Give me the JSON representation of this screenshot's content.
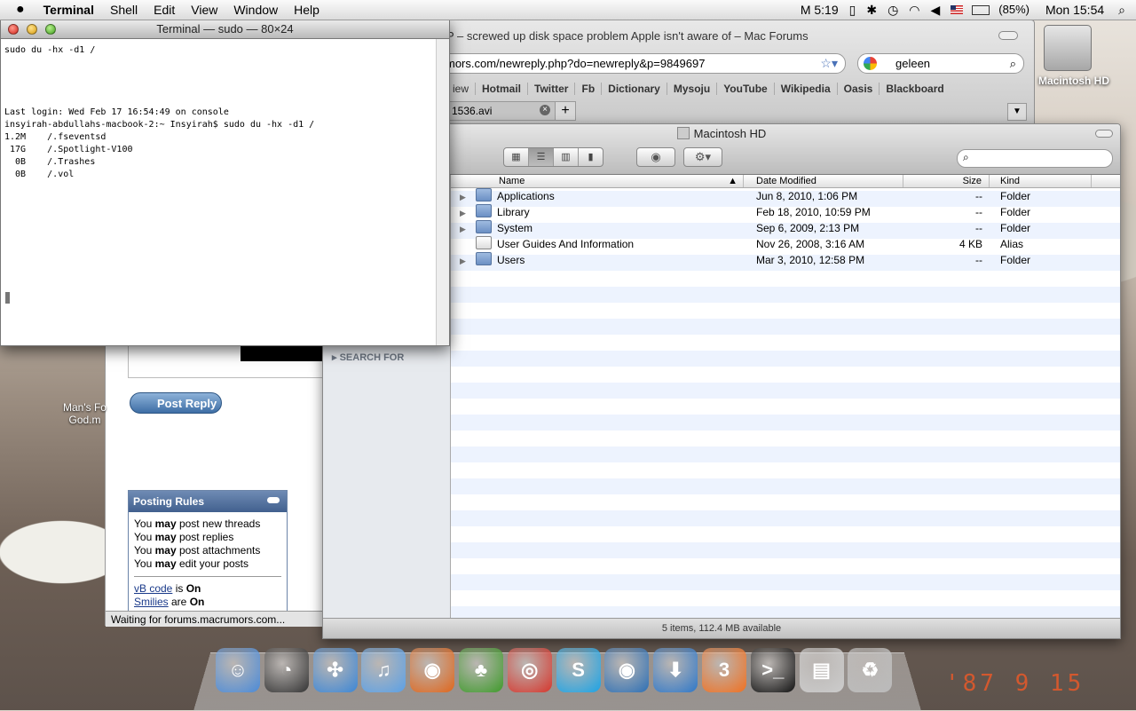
{
  "menubar": {
    "app": "Terminal",
    "items": [
      "Shell",
      "Edit",
      "View",
      "Window",
      "Help"
    ],
    "status": {
      "clock_app": "M 5:19",
      "battery": "(85%)",
      "datetime": "Mon 15:54"
    }
  },
  "terminal": {
    "title": "Terminal — sudo — 80×24",
    "lines": "sudo du -hx -d1 /\n\n\n\n\nLast login: Wed Feb 17 16:54:49 on console\ninsyirah-abdullahs-macbook-2:~ Insyirah$ sudo du -hx -d1 /\n1.2M    /.fseventsd\n 17G    /.Spotlight-V100\n  0B    /.Trashes\n  0B    /.vol"
  },
  "browser": {
    "title": "P – screwed up disk space problem Apple isn't aware of – Mac Forums",
    "url": "mors.com/newreply.php?do=newreply&p=9849697",
    "search_value": "geleen",
    "bookmarks": [
      "iew",
      "Hotmail",
      "Twitter",
      "Fb",
      "Dictionary",
      "Mysoju",
      "YouTube",
      "Wikipedia",
      "Oasis",
      "Blackboard"
    ],
    "tab_label": "1536.avi"
  },
  "forum": {
    "post_reply": "Post Reply",
    "rules_title": "Posting Rules",
    "rules": [
      {
        "pre": "You ",
        "bold": "may",
        "post": " post new threads"
      },
      {
        "pre": "You ",
        "bold": "may",
        "post": " post replies"
      },
      {
        "pre": "You ",
        "bold": "may",
        "post": " post attachments"
      },
      {
        "pre": "You ",
        "bold": "may",
        "post": " edit your posts"
      }
    ],
    "vbcode_link": "vB code",
    "vbcode_state": "On",
    "smilies_link": "Smilies",
    "smilies_state": "On",
    "is_text": " is ",
    "are_text": " are ",
    "status": "Waiting for forums.macrumors.com...",
    "desktop_caption": "Man's Fo God.m"
  },
  "finder": {
    "title": "Macintosh HD",
    "search_placeholder": "",
    "sidebar_section": "SEARCH FOR",
    "columns": {
      "name": "Name",
      "date": "Date Modified",
      "size": "Size",
      "kind": "Kind"
    },
    "rows": [
      {
        "name": "Applications",
        "date": "Jun 8, 2010, 1:06 PM",
        "size": "--",
        "kind": "Folder"
      },
      {
        "name": "Library",
        "date": "Feb 18, 2010, 10:59 PM",
        "size": "--",
        "kind": "Folder"
      },
      {
        "name": "System",
        "date": "Sep 6, 2009, 2:13 PM",
        "size": "--",
        "kind": "Folder"
      },
      {
        "name": "User Guides And Information",
        "date": "Nov 26, 2008, 3:16 AM",
        "size": "4 KB",
        "kind": "Alias"
      },
      {
        "name": "Users",
        "date": "Mar 3, 2010, 12:58 PM",
        "size": "--",
        "kind": "Folder"
      }
    ],
    "status": "5 items, 112.4 MB available"
  },
  "desktop": {
    "hd_label": "Macintosh HD",
    "date_stamp": "'87 9 15"
  },
  "dock": {
    "apps": [
      {
        "name": "finder",
        "glyph": "☺",
        "color": "#4a8ad8"
      },
      {
        "name": "dashboard",
        "glyph": "◔",
        "color": "#333333"
      },
      {
        "name": "safari",
        "glyph": "✣",
        "color": "#3b86d6"
      },
      {
        "name": "itunes",
        "glyph": "♫",
        "color": "#5aa0e6"
      },
      {
        "name": "firefox",
        "glyph": "◉",
        "color": "#e0661b"
      },
      {
        "name": "adium",
        "glyph": "♣",
        "color": "#3e9a2a"
      },
      {
        "name": "chrome",
        "glyph": "◎",
        "color": "#d6362c"
      },
      {
        "name": "skype",
        "glyph": "S",
        "color": "#1aa3e6"
      },
      {
        "name": "preview",
        "glyph": "◉",
        "color": "#2c6fb5"
      },
      {
        "name": "downloader",
        "glyph": "⬇",
        "color": "#2e77c8"
      },
      {
        "name": "three-app",
        "glyph": "3",
        "color": "#f07020"
      },
      {
        "name": "terminal",
        "glyph": ">_",
        "color": "#111111"
      },
      {
        "name": "document",
        "glyph": "▤",
        "color": "#cccccc"
      },
      {
        "name": "trash",
        "glyph": "♻",
        "color": "#bbbbbb"
      }
    ]
  }
}
